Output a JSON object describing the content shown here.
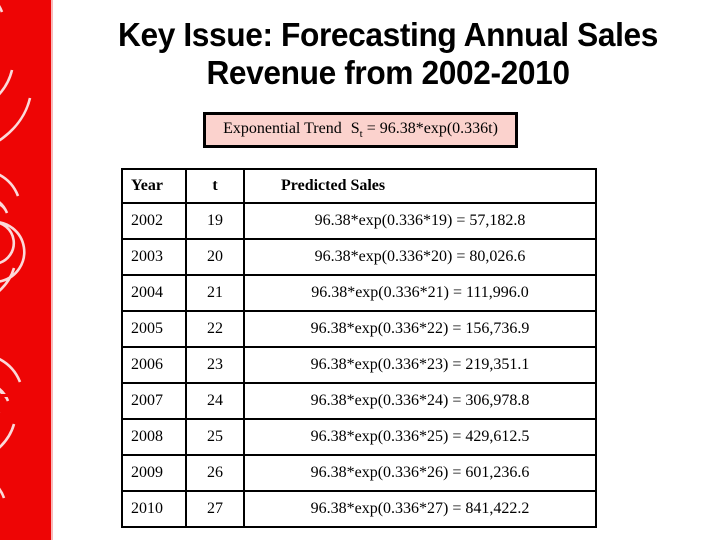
{
  "slide": {
    "title_line1": "Key Issue: Forecasting Annual Sales",
    "title_line2": "Revenue from 2002-2010",
    "background_color": "#ffffff",
    "accent_color": "#ee0505",
    "formula_box_color": "#fbd2cd"
  },
  "formula": {
    "label": "Exponential Trend",
    "symbol": "S",
    "subscript": "t",
    "equation": "= 96.38*exp(0.336t)",
    "full_text": "Exponential Trend  St = 96.38*exp(0.336t)"
  },
  "table": {
    "headers": [
      "Year",
      "t",
      "Predicted Sales"
    ],
    "rows": [
      {
        "year": "2002",
        "t": "19",
        "predicted": "96.38*exp(0.336*19) =  57,182.8"
      },
      {
        "year": "2003",
        "t": "20",
        "predicted": "96.38*exp(0.336*20) =  80,026.6"
      },
      {
        "year": "2004",
        "t": "21",
        "predicted": "96.38*exp(0.336*21) = 111,996.0"
      },
      {
        "year": "2005",
        "t": "22",
        "predicted": "96.38*exp(0.336*22) = 156,736.9"
      },
      {
        "year": "2006",
        "t": "23",
        "predicted": "96.38*exp(0.336*23) = 219,351.1"
      },
      {
        "year": "2007",
        "t": "24",
        "predicted": "96.38*exp(0.336*24) = 306,978.8"
      },
      {
        "year": "2008",
        "t": "25",
        "predicted": "96.38*exp(0.336*25) = 429,612.5"
      },
      {
        "year": "2009",
        "t": "26",
        "predicted": "96.38*exp(0.336*26) = 601,236.6"
      },
      {
        "year": "2010",
        "t": "27",
        "predicted": "96.38*exp(0.336*27) = 841,422.2"
      }
    ]
  },
  "decoration": {
    "sidebar_name": "red-spiral-band",
    "spiral_count": 6
  }
}
